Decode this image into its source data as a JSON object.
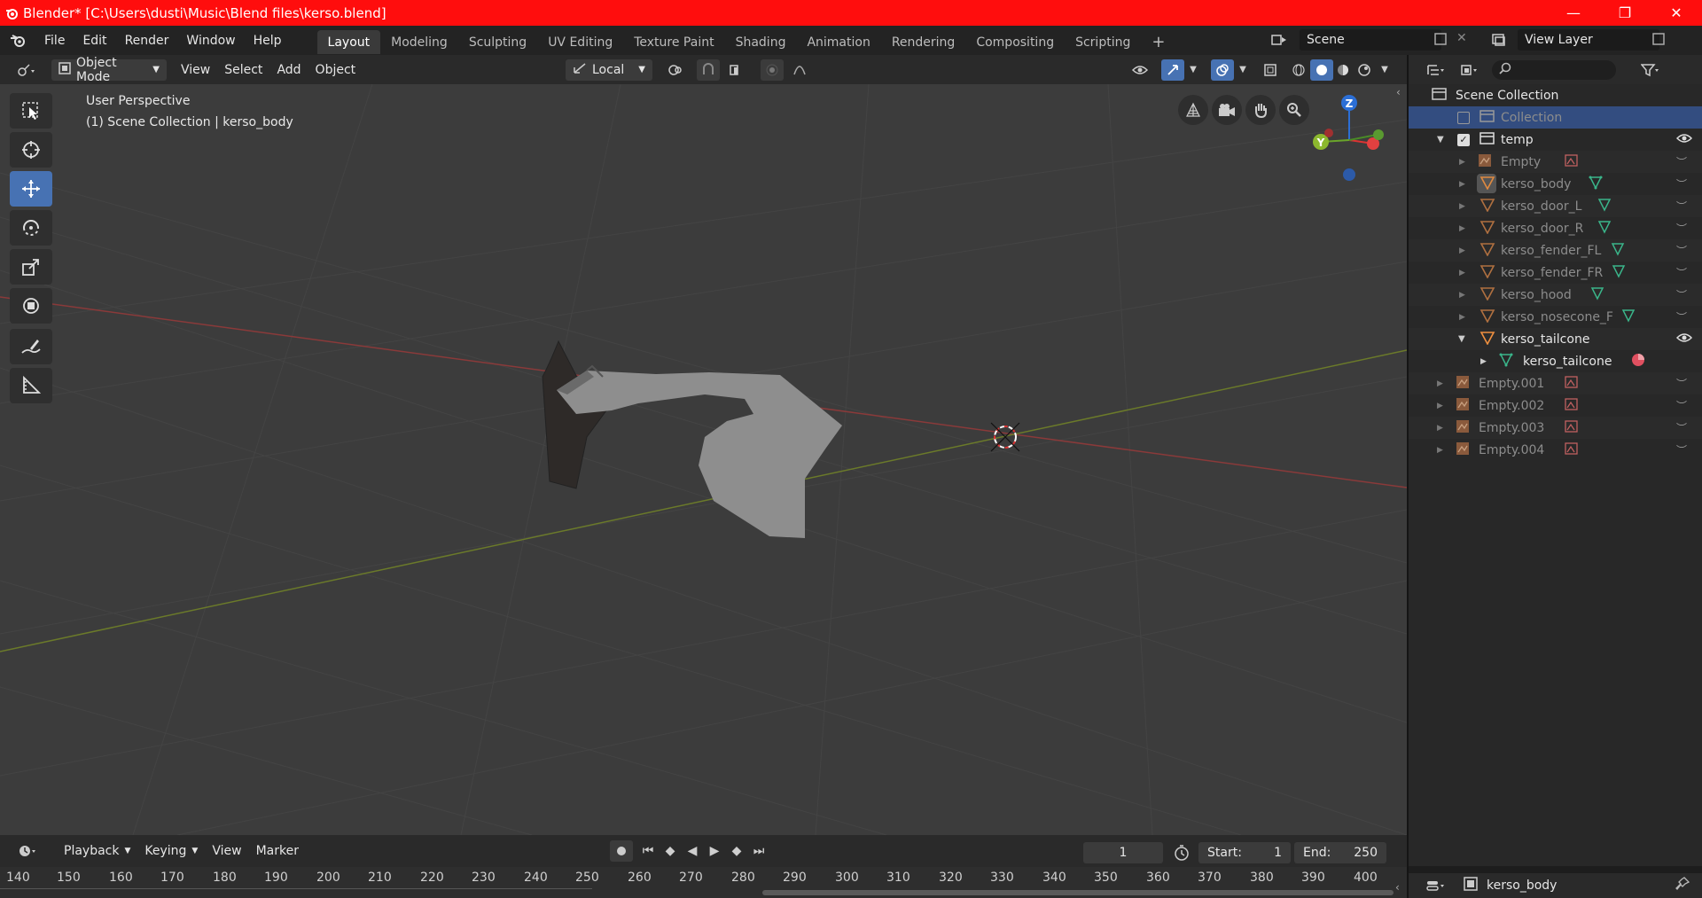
{
  "window": {
    "title": "Blender* [C:\\Users\\dusti\\Music\\Blend files\\kerso.blend]",
    "minimize": "—",
    "maximize": "❐",
    "close": "✕"
  },
  "menu": [
    "File",
    "Edit",
    "Render",
    "Window",
    "Help"
  ],
  "workspaces": [
    "Layout",
    "Modeling",
    "Sculpting",
    "UV Editing",
    "Texture Paint",
    "Shading",
    "Animation",
    "Rendering",
    "Compositing",
    "Scripting"
  ],
  "workspace_add": "+",
  "scene": {
    "name": "Scene",
    "view_layer": "View Layer"
  },
  "viewport_header": {
    "mode": "Object Mode",
    "menus": [
      "View",
      "Select",
      "Add",
      "Object"
    ],
    "orientation": "Local"
  },
  "viewport": {
    "perspective": "User Perspective",
    "collection_info": "(1) Scene Collection | kerso_body",
    "gizmo": {
      "z": "Z",
      "y": "Y"
    }
  },
  "outliner": {
    "rows": [
      {
        "label": "Scene Collection",
        "style": "bright"
      },
      {
        "label": "Collection",
        "style": "dim"
      },
      {
        "label": "temp",
        "style": "bright"
      },
      {
        "label": "Empty",
        "style": "dim"
      },
      {
        "label": "kerso_body",
        "style": "dim"
      },
      {
        "label": "kerso_door_L",
        "style": "dim"
      },
      {
        "label": "kerso_door_R",
        "style": "dim"
      },
      {
        "label": "kerso_fender_FL",
        "style": "dim"
      },
      {
        "label": "kerso_fender_FR",
        "style": "dim"
      },
      {
        "label": "kerso_hood",
        "style": "dim"
      },
      {
        "label": "kerso_nosecone_F",
        "style": "dim"
      },
      {
        "label": "kerso_tailcone",
        "style": "bright"
      },
      {
        "label": "kerso_tailcone",
        "style": "bright"
      },
      {
        "label": "Empty.001",
        "style": "dim"
      },
      {
        "label": "Empty.002",
        "style": "dim"
      },
      {
        "label": "Empty.003",
        "style": "dim"
      },
      {
        "label": "Empty.004",
        "style": "dim"
      }
    ]
  },
  "timeline": {
    "menus": [
      "Playback",
      "Keying",
      "View",
      "Marker"
    ],
    "current_frame": "1",
    "start_label": "Start:",
    "start": "1",
    "end_label": "End:",
    "end": "250",
    "ticks": [
      "140",
      "150",
      "160",
      "170",
      "180",
      "190",
      "200",
      "210",
      "220",
      "230",
      "240",
      "250",
      "260",
      "270",
      "280",
      "290",
      "300",
      "310",
      "320",
      "330",
      "340",
      "350",
      "360",
      "370",
      "380",
      "390",
      "400"
    ]
  },
  "properties": {
    "active_object": "kerso_body"
  },
  "colors": {
    "titlebar": "#ff0d0d",
    "active_tool": "#4772b3",
    "selection": "#334d80"
  }
}
